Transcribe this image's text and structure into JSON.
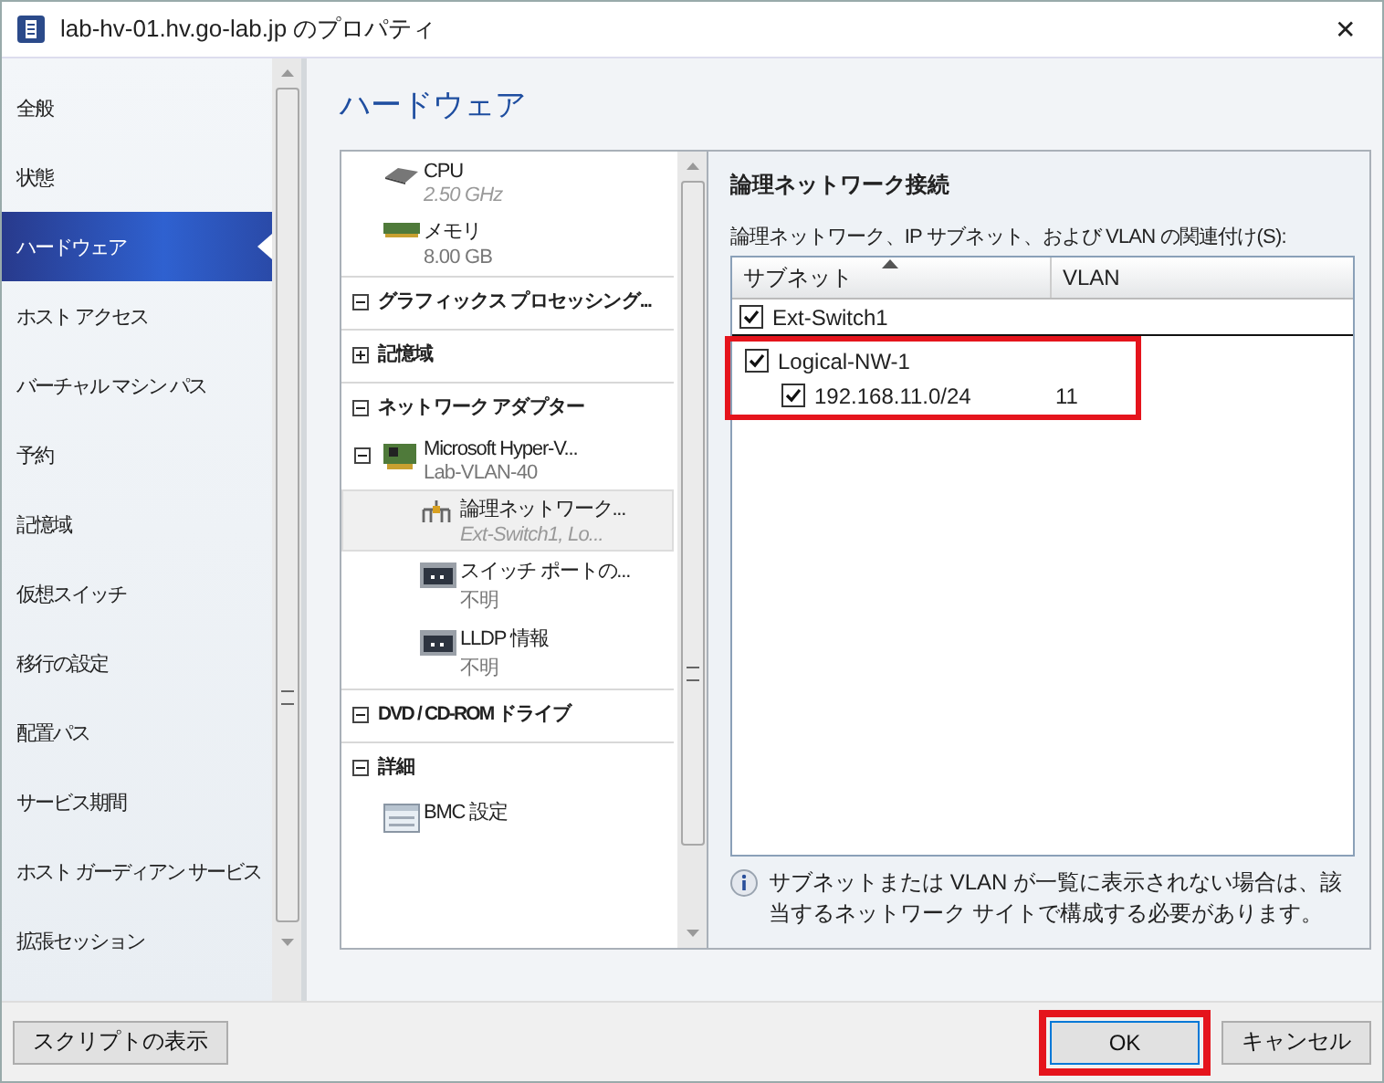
{
  "window": {
    "title": "lab-hv-01.hv.go-lab.jp のプロパティ",
    "close": "✕"
  },
  "sidebar": {
    "items": [
      {
        "label": "全般",
        "selected": false
      },
      {
        "label": "状態",
        "selected": false
      },
      {
        "label": "ハードウェア",
        "selected": true
      },
      {
        "label": "ホスト アクセス",
        "selected": false
      },
      {
        "label": "バーチャル マシン パス",
        "selected": false
      },
      {
        "label": "予約",
        "selected": false
      },
      {
        "label": "記憶域",
        "selected": false
      },
      {
        "label": "仮想スイッチ",
        "selected": false
      },
      {
        "label": "移行の設定",
        "selected": false
      },
      {
        "label": "配置パス",
        "selected": false
      },
      {
        "label": "サービス期間",
        "selected": false
      },
      {
        "label": "ホスト ガーディアン サービス",
        "selected": false
      },
      {
        "label": "拡張セッション",
        "selected": false
      }
    ]
  },
  "page_title": "ハードウェア",
  "hardware_tree": [
    {
      "kind": "cpu",
      "label": "CPU",
      "detail": "2.50 GHz",
      "italic": true,
      "selected": false
    },
    {
      "kind": "memory",
      "label": "メモリ",
      "detail": "8.00 GB",
      "italic": false,
      "selected": false
    },
    {
      "kind": "section",
      "label": "グラフィックス プロセッシング...",
      "expanded": true
    },
    {
      "kind": "section",
      "label": "記憶域",
      "expanded": false
    },
    {
      "kind": "section",
      "label": "ネットワーク アダプター",
      "expanded": true,
      "children": [
        {
          "kind": "adapter",
          "label": "Microsoft Hyper-V...",
          "detail": "Lab-VLAN-40",
          "italic": false,
          "selected": false,
          "expanded": true,
          "children": [
            {
              "kind": "network",
              "label": "論理ネットワーク...",
              "detail": "Ext-Switch1, Lo...",
              "italic": true,
              "selected": true
            },
            {
              "kind": "port",
              "label": "スイッチ ポートの...",
              "detail": "不明",
              "italic": false,
              "selected": false
            },
            {
              "kind": "port",
              "label": "LLDP 情報",
              "detail": "不明",
              "italic": false,
              "selected": false
            }
          ]
        }
      ]
    },
    {
      "kind": "section",
      "label": "DVD / CD-ROM ドライブ",
      "expanded": true
    },
    {
      "kind": "section",
      "label": "詳細",
      "expanded": true,
      "children": [
        {
          "kind": "bmc",
          "label": "BMC 設定",
          "selected": false
        }
      ]
    }
  ],
  "details": {
    "heading": "論理ネットワーク接続",
    "table_label": "論理ネットワーク、IP サブネット、および VLAN の関連付け(S):",
    "columns": [
      {
        "label": "サブネット",
        "sorted": true
      },
      {
        "label": "VLAN",
        "sorted": false
      }
    ],
    "rows": [
      {
        "label": "Ext-Switch1",
        "checked": true,
        "focused": true,
        "highlighted": false
      },
      {
        "label": "Logical-NW-1",
        "checked": true,
        "focused": false,
        "highlighted": true,
        "children": [
          {
            "label": "192.168.11.0/24",
            "vlan": "11",
            "checked": true
          }
        ]
      }
    ],
    "note": "サブネットまたは VLAN が一覧に表示されない場合は、該当するネットワーク サイトで構成する必要があります。"
  },
  "buttons": [
    {
      "kind": "left",
      "label": "スクリプトの表示",
      "default": false,
      "highlighted": false
    },
    {
      "kind": "right",
      "label": "OK",
      "default": true,
      "highlighted": true
    },
    {
      "kind": "right",
      "label": "キャンセル",
      "default": false,
      "highlighted": false
    }
  ]
}
